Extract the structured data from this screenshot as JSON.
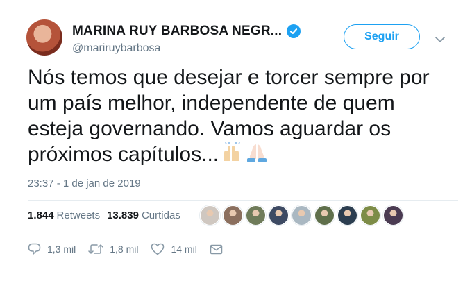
{
  "header": {
    "display_name": "MARINA RUY BARBOSA NEGR...",
    "handle": "@mariruybarbosa",
    "verified_icon": "verified-badge-icon",
    "follow_label": "Seguir",
    "menu_icon": "chevron-down-icon"
  },
  "tweet": {
    "text": "Nós temos que desejar e torcer sempre por\num país melhor, independente de quem\nesteja governando. Vamos aguardar os\npróximos capítulos...",
    "emojis": [
      "raising-hands-emoji",
      "folded-hands-emoji"
    ],
    "timestamp": "23:37 - 1 de jan de 2019"
  },
  "stats": {
    "retweets_count": "1.844",
    "retweets_label": "Retweets",
    "likes_count": "13.839",
    "likes_label": "Curtidas"
  },
  "liked_by_avatars": [
    {
      "color": "#cfc7c0"
    },
    {
      "color": "#8b6f5e"
    },
    {
      "color": "#6f7b5a"
    },
    {
      "color": "#3d4a63"
    },
    {
      "color": "#aab8c2"
    },
    {
      "color": "#5f6f4b"
    },
    {
      "color": "#2c3e50"
    },
    {
      "color": "#7d8c47"
    },
    {
      "color": "#4b3b52"
    }
  ],
  "actions": {
    "replies": "1,3 mil",
    "retweets": "1,8 mil",
    "likes": "14 mil"
  },
  "colors": {
    "accent": "#1da1f2",
    "muted": "#657786",
    "text": "#14171a",
    "divider": "#e6ecf0"
  }
}
